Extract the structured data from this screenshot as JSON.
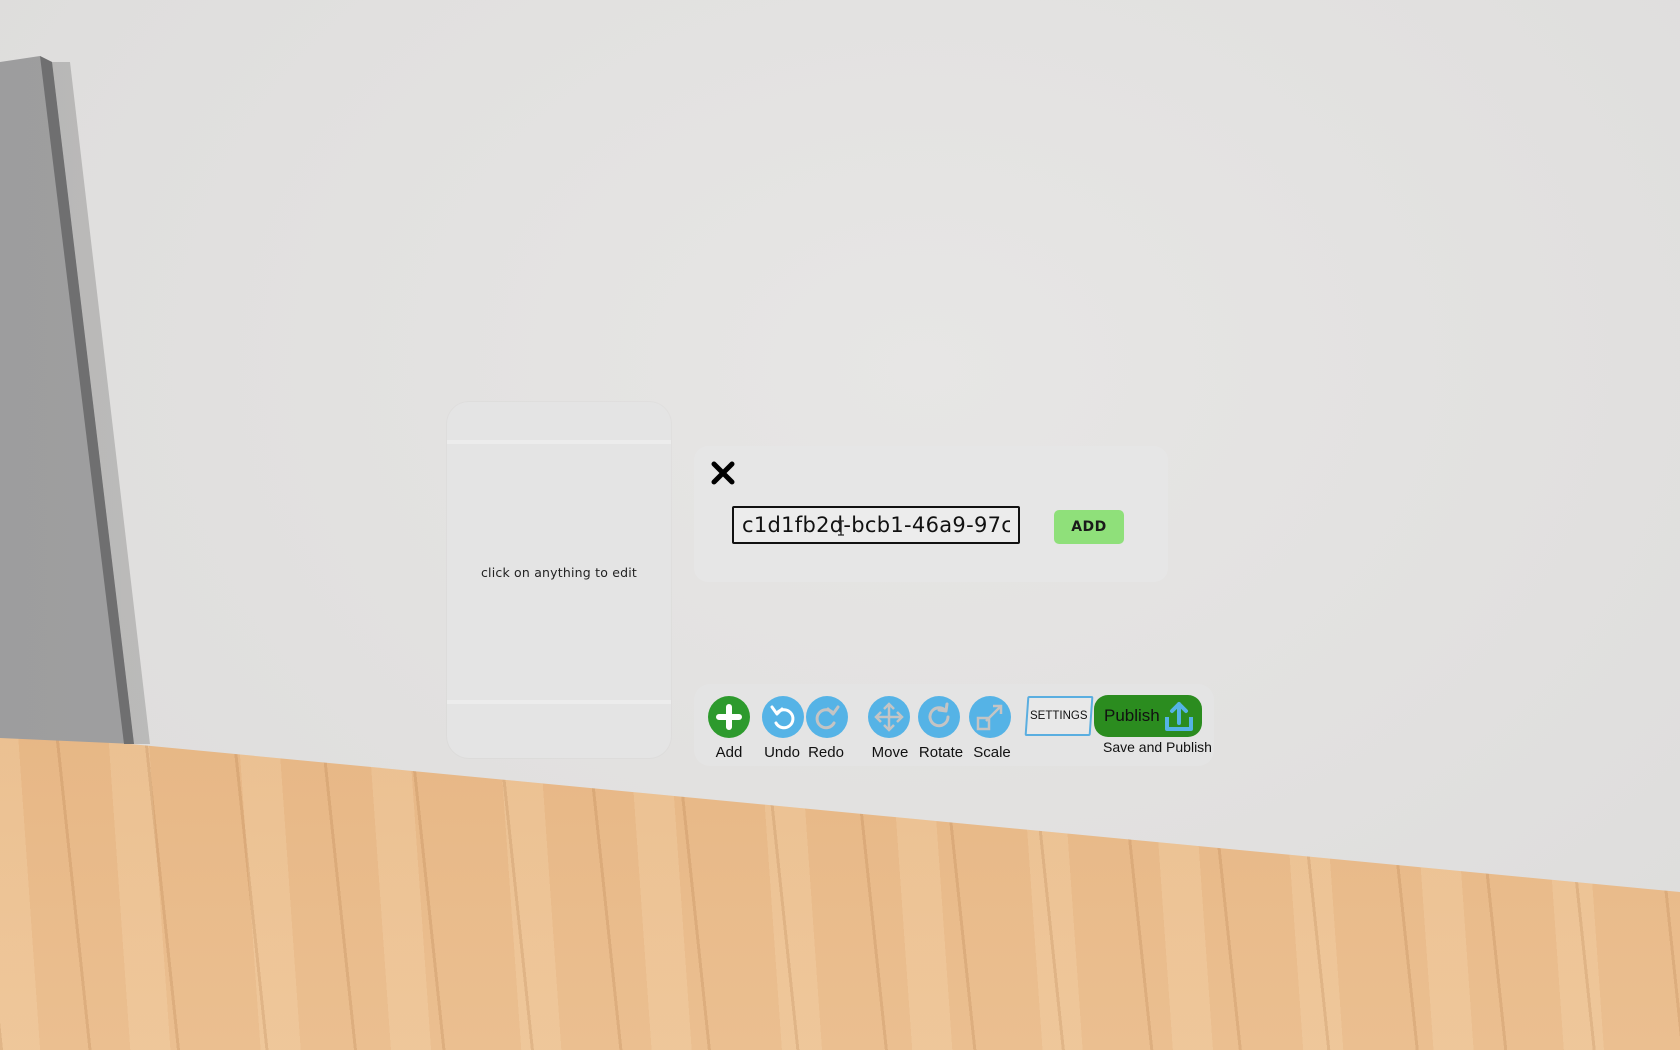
{
  "panel": {
    "hint": "click on anything to edit"
  },
  "dialog": {
    "input_value": "c1d1fb2d-bcb1-46a9-97c",
    "add_label": "ADD"
  },
  "toolbar": {
    "add_label": "Add",
    "undo_label": "Undo",
    "redo_label": "Redo",
    "move_label": "Move",
    "rotate_label": "Rotate",
    "scale_label": "Scale",
    "settings_label": "SETTINGS",
    "publish_label": "Publish",
    "publish_sub_label": "Save and Publish"
  },
  "colors": {
    "tool_blue": "#55b3e6",
    "add_green": "#2d9a2d",
    "publish_green": "#2b8c1f",
    "add_button_green": "#8fe07a"
  },
  "icons": [
    "close-icon",
    "plus-icon",
    "undo-icon",
    "redo-icon",
    "move-icon",
    "rotate-icon",
    "scale-icon",
    "upload-icon"
  ]
}
